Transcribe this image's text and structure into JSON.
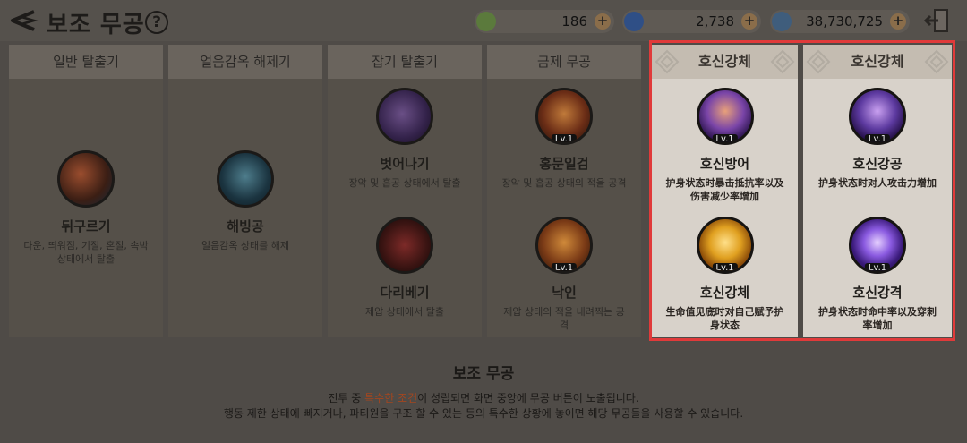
{
  "header": {
    "title": "보조 무공",
    "help_label": "?",
    "resources": [
      {
        "icon": "jade-coin-icon",
        "value": "186",
        "color": "#5b7a3c"
      },
      {
        "icon": "blue-gem-icon",
        "value": "2,738",
        "color": "#2f4f86"
      },
      {
        "icon": "silver-coin-icon",
        "value": "38,730,725",
        "color": "#3f5d7c"
      }
    ],
    "plus_label": "+"
  },
  "columns": [
    {
      "tab": "일반 탈출기",
      "skills": [
        {
          "name": "뒤구르기",
          "desc": "다운, 띄워짐, 기절, 혼절, 속박 상태에서 탈출",
          "level": ""
        }
      ]
    },
    {
      "tab": "얼음감옥 해제기",
      "skills": [
        {
          "name": "해빙공",
          "desc": "얼음감옥 상태를 해제",
          "level": ""
        }
      ]
    },
    {
      "tab": "잡기 탈출기",
      "skills": [
        {
          "name": "벗어나기",
          "desc": "장악 및 흡공 상태에서 탈출",
          "level": ""
        },
        {
          "name": "다리베기",
          "desc": "제압 상태에서 탈출",
          "level": ""
        }
      ]
    },
    {
      "tab": "금제 무공",
      "skills": [
        {
          "name": "홍문일검",
          "desc": "장악 및 흡공 상태의 적을 공격",
          "level": "Lv.1"
        },
        {
          "name": "낙인",
          "desc": "제압 상태의 적을 내려찍는 공격",
          "level": "Lv.1"
        }
      ]
    },
    {
      "tab": "호신강체",
      "skills": [
        {
          "name": "호신방어",
          "desc": "护身状态时暴击抵抗率以及伤害减少率增加",
          "level": "Lv.1"
        },
        {
          "name": "호신강체",
          "desc": "生命值见底时对自己赋予护身状态",
          "level": "Lv.1"
        }
      ]
    },
    {
      "tab": "호신강체",
      "skills": [
        {
          "name": "호신강공",
          "desc": "护身状态时对人攻击力增加",
          "level": "Lv.1"
        },
        {
          "name": "호신강격",
          "desc": "护身状态时命中率以及穿刺率增加",
          "level": "Lv.1"
        }
      ]
    }
  ],
  "info": {
    "title": "보조 무공",
    "line1_pre": "전투 중 ",
    "line1_accent": "특수한 조건",
    "line1_post": "이 성립되면 화면 중앙에 무공 버튼이 노출됩니다.",
    "line2": "행동 제한 상태에 빠지거나, 파티원을 구조 할 수 있는 등의 특수한 상황에 놓이면 해당 무공들을 사용할 수 있습니다."
  },
  "colors": {
    "highlight": "#e03a3a",
    "accent": "#a3461f"
  }
}
